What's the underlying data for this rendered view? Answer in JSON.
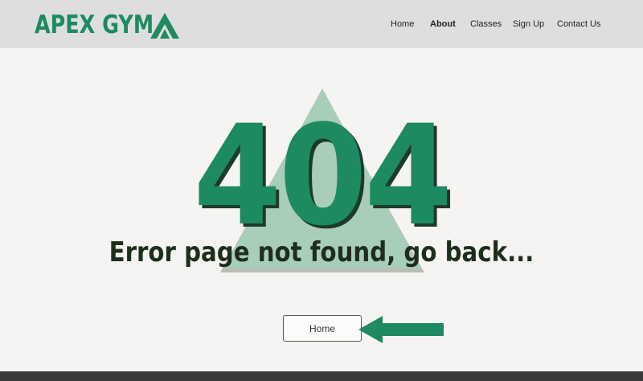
{
  "brand": {
    "name": "APEX GYM",
    "accent_color": "#1e8a5f",
    "icon": "mountain-chevron-icon"
  },
  "nav": {
    "items": [
      {
        "label": "Home",
        "active": false
      },
      {
        "label": "About",
        "active": true
      },
      {
        "label": "Classes",
        "active": false
      },
      {
        "label": "Sign Up",
        "active": false
      },
      {
        "label": "Contact Us",
        "active": false
      }
    ]
  },
  "error": {
    "code": "404",
    "message": "Error page not found, go back...",
    "code_color": "#1e8a5f",
    "message_color": "#1e2e1c"
  },
  "actions": {
    "home_label": "Home",
    "pointer_icon": "left-arrow-icon"
  }
}
